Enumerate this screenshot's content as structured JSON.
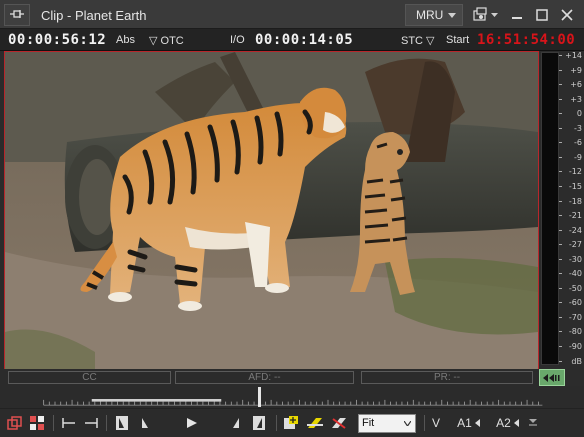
{
  "window": {
    "title": "Clip - Planet Earth",
    "mru_label": "MRU"
  },
  "timecodes": {
    "position": "00:00:56:12",
    "position_mode": "Abs",
    "position_source": "▽ OTC",
    "io_label": "I/O",
    "duration": "00:00:14:05",
    "stc_label": "STC ▽",
    "start_label": "Start",
    "start_tc": "16:51:54:00"
  },
  "status_fields": {
    "cc": "CC",
    "afd": "AFD: --",
    "pr": "PR: --"
  },
  "meter": {
    "labels": [
      "+14",
      "+9",
      "+6",
      "+3",
      "0",
      "-3",
      "-6",
      "-9",
      "-12",
      "-15",
      "-18",
      "-21",
      "-24",
      "-27",
      "-30",
      "-40",
      "-50",
      "-60",
      "-70",
      "-80",
      "-90",
      "dB"
    ]
  },
  "toolbar": {
    "zoom_value": "Fit",
    "video_label": "V",
    "audio1_label": "A1",
    "audio2_label": "A2"
  },
  "colors": {
    "accent_red": "#d8141a",
    "frame_border": "#b8262b",
    "meter_button": "#69a86b"
  },
  "icons": [
    "pin-icon",
    "settings-icon",
    "minimize-icon",
    "maximize-icon",
    "close-icon",
    "mark-in-icon",
    "mark-out-icon",
    "play-icon",
    "speaker-icon"
  ]
}
